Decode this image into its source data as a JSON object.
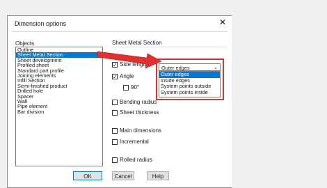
{
  "dialog": {
    "title": "Dimension options",
    "close_glyph": "✕",
    "objects_label": "Objects",
    "objects": [
      "Outline",
      "Sheet Metal Section",
      "Sheet development",
      "Profiled sheet",
      "Standard part profile",
      "Joining elements",
      "Infill Section",
      "Semi-finished product",
      "Drilled hole",
      "Spacer",
      "Wall",
      "Pipe element",
      "Bar division"
    ],
    "selected_object": "Sheet Metal Section",
    "group_title": "Sheet Metal Section",
    "options": {
      "side_lengths": "Side lengths",
      "angle": "Angle",
      "ninety": "90°",
      "bending_radius": "Bending radius",
      "sheet_thickness": "Sheet thickness",
      "main_dimensions": "Main dimensions",
      "incremental": "Incremental",
      "rolled_radius": "Rolled radius"
    },
    "edge_combo": {
      "value": "Outer edges",
      "options": [
        "Outer edges",
        "Inside edges",
        "System points outside",
        "System points inside"
      ]
    },
    "buttons": {
      "ok": "OK",
      "cancel": "Cancel",
      "help": "Help"
    }
  },
  "colors": {
    "highlight_red": "#e03030",
    "selection_blue": "#0078d7"
  },
  "icons": {
    "close": "close-icon",
    "combo": "chevron-down-icon",
    "arrow": "annotation-arrow"
  }
}
